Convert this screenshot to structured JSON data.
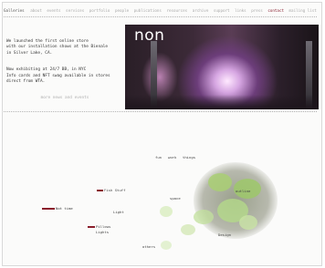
{
  "topbar": {
    "brand": "Galleries",
    "nav": [
      "about",
      "events",
      "services",
      "portfolio",
      "people",
      "publications",
      "resources",
      "archive",
      "support",
      "links",
      "press",
      "contact",
      "mailing list",
      "blog"
    ],
    "highlight_index": 11
  },
  "news": [
    {
      "lines": [
        "We launched the first online store",
        "with our installation shows at the Bienale",
        "in Silver Lake, CA."
      ]
    },
    {
      "lines": [
        "Now exhibiting at 24/7 BB, in NYC",
        "Info cards and NFT swag available in stores",
        "direct from WTA."
      ]
    }
  ],
  "news_more": "more news and events",
  "hero": {
    "title": "non"
  },
  "wordmap": {
    "words": [
      "fun",
      "work",
      "things",
      "space",
      "outline",
      "Fish Stuff",
      "Light",
      "Not time",
      "Pillows",
      "Lights",
      "Design",
      "others"
    ]
  },
  "colors": {
    "accent": "#8a1e2b",
    "hero_bg": "#3c2a38"
  }
}
